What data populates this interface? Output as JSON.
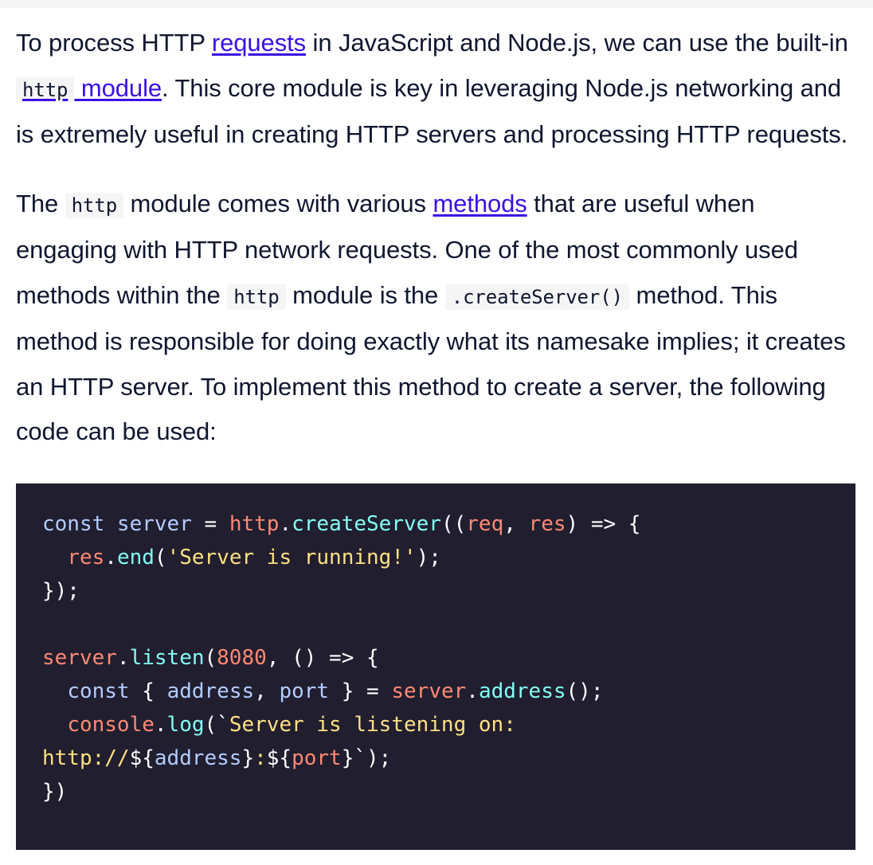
{
  "paragraph1": {
    "t1": "To process HTTP ",
    "link_requests": "requests",
    "t2": " in JavaScript and Node.js, we can use the built-in ",
    "link_code": "http",
    "link_module": " module",
    "t3": ". This core module is key in leveraging Node.js networking and is extremely useful in creating HTTP servers and processing HTTP requests."
  },
  "paragraph2": {
    "t1": "The ",
    "code1": "http",
    "t2": " module comes with various ",
    "link_methods": "methods",
    "t3": " that are useful when engaging with HTTP network requests. One of the most commonly used methods within the ",
    "code2": "http",
    "t4": " module is the ",
    "code3": ".createServer()",
    "t5": " method. This method is responsible for doing exactly what its namesake implies; it creates an HTTP server. To implement this method to create a server, the following code can be used:"
  },
  "code": {
    "l1": [
      "const",
      " server",
      " = ",
      "http",
      ".",
      "createServer",
      "((",
      "req",
      ", ",
      "res",
      ") => {"
    ],
    "l2": [
      "  ",
      "res",
      ".",
      "end",
      "(",
      "'Server is running!'",
      ");"
    ],
    "l3": [
      "});"
    ],
    "l4": [
      ""
    ],
    "l5": [
      "server",
      ".",
      "listen",
      "(",
      "8080",
      ", () => {"
    ],
    "l6": [
      "  ",
      "const",
      " { ",
      "address",
      ", ",
      "port",
      " } = ",
      "server",
      ".",
      "address",
      "();"
    ],
    "l7": [
      "  ",
      "console",
      ".",
      "log",
      "(`",
      "Server is listening on:"
    ],
    "l8": [
      "http://",
      "${",
      "address",
      "}",
      ":",
      "${",
      "port",
      "}",
      "`);"
    ],
    "l9": [
      "})"
    ]
  }
}
